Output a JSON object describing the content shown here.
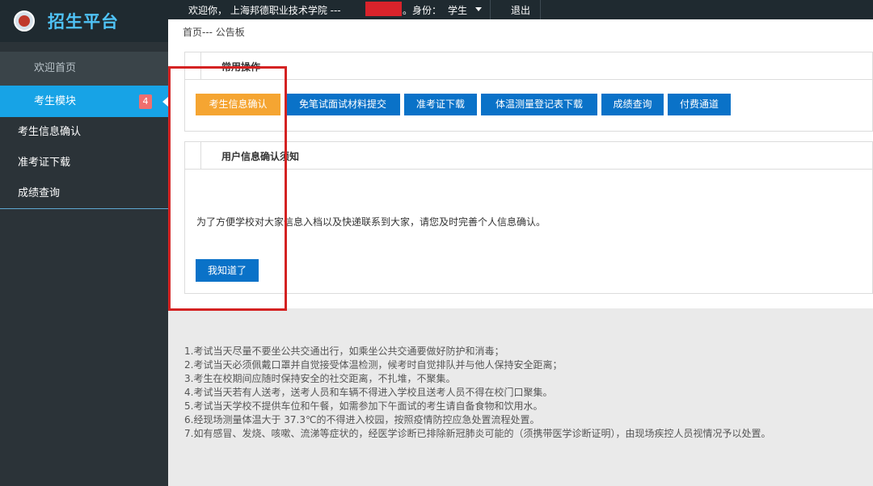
{
  "app": {
    "title": "招生平台"
  },
  "topbar": {
    "welcome": "欢迎你， 上海邦德职业技术学院 ---",
    "suffix": "。",
    "role_label": "身份：",
    "role": "学生",
    "logout": "退出"
  },
  "sidebar": {
    "welcome_item": "欢迎首页",
    "active_item": "考生模块",
    "badge": "4",
    "sub_items": [
      "考生信息确认",
      "准考证下载",
      "成绩查询"
    ]
  },
  "breadcrumb": "首页--- 公告板",
  "operations": {
    "title": "常用操作",
    "buttons": [
      "考生信息确认",
      "免笔试面试材料提交",
      "准考证下载",
      "体温测量登记表下载",
      "成绩查询",
      "付费通道"
    ]
  },
  "notice": {
    "title": "用户信息确认须知",
    "text": "为了方便学校对大家信息入档以及快递联系到大家，请您及时完善个人信息确认。",
    "ack_button": "我知道了"
  },
  "rules": [
    "1.考试当天尽量不要坐公共交通出行，如乘坐公共交通要做好防护和消毒；",
    "2.考试当天必须佩戴口罩并自觉接受体温检测，候考时自觉排队并与他人保持安全距离；",
    "3.考生在校期间应随时保持安全的社交距离，不扎堆，不聚集。",
    "4.考试当天若有人送考，送考人员和车辆不得进入学校且送考人员不得在校门口聚集。",
    "5.考试当天学校不提供车位和午餐，如需参加下午面试的考生请自备食物和饮用水。",
    "6.经现场测量体温大于 37.3℃的不得进入校园，按照疫情防控应急处置流程处置。",
    "7.如有感冒、发烧、咳嗽、流涕等症状的，经医学诊断已排除新冠肺炎可能的（须携带医学诊断证明），由现场疾控人员视情况予以处置。"
  ],
  "colors": {
    "accent": "#17a3e6",
    "button": "#0a72c8",
    "primary_button": "#f5a532",
    "annotation": "#d42222"
  }
}
